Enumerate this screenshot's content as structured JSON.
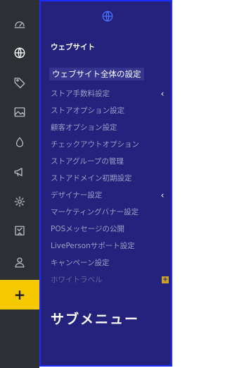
{
  "rail": {
    "icons": [
      "dashboard-icon",
      "globe-icon",
      "tag-icon",
      "image-icon",
      "droplet-icon",
      "megaphone-icon",
      "gear-icon",
      "bookmark-icon",
      "user-icon"
    ],
    "add_label": "+"
  },
  "panel": {
    "title": "ウェブサイト",
    "items": [
      {
        "label": "ウェブサイト全体の設定"
      },
      {
        "label": "ストア手数料設定"
      },
      {
        "label": "ストアオプション設定"
      },
      {
        "label": "顧客オプション設定"
      },
      {
        "label": "チェックアウトオプション"
      },
      {
        "label": "ストアグループの管理"
      },
      {
        "label": "ストアドメイン初期設定"
      },
      {
        "label": "デザイナー設定"
      },
      {
        "label": "マーケティングバナー設定"
      },
      {
        "label": "POSメッセージの公開"
      },
      {
        "label": "LivePersonサポート設定"
      },
      {
        "label": "キャンペーン設定"
      },
      {
        "label": "ホワイトラベル"
      }
    ],
    "chevron": "‹",
    "badge": "+",
    "caption": "サブメニュー"
  },
  "colors": {
    "rail_bg": "#2c3034",
    "panel_bg": "#24227c",
    "accent_yellow": "#f6c800",
    "highlight_border": "#1d2bff"
  }
}
